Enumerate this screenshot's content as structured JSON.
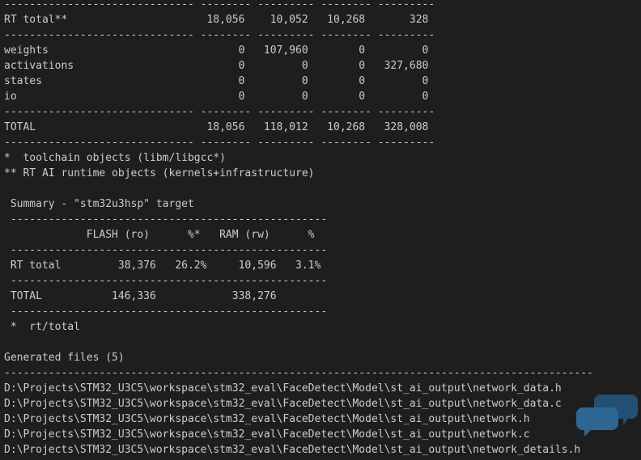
{
  "terminal": {
    "lines": [
      "------------------------------ -------- --------- -------- ---------",
      "RT total**                      18,056    10,052   10,268       328",
      "------------------------------ -------- --------- -------- ---------",
      "weights                              0   107,960        0         0",
      "activations                          0         0        0   327,680",
      "states                               0         0        0         0",
      "io                                   0         0        0         0",
      "------------------------------ -------- --------- -------- ---------",
      "TOTAL                           18,056   118,012   10,268   328,008",
      "------------------------------ -------- --------- -------- ---------",
      "*  toolchain objects (libm/libgcc*)",
      "** RT AI runtime objects (kernels+infrastructure)",
      "",
      " Summary - \"stm32u3hsp\" target",
      " --------------------------------------------------",
      "             FLASH (ro)      %*   RAM (rw)      %",
      " --------------------------------------------------",
      " RT total         38,376   26.2%     10,596   3.1%",
      " --------------------------------------------------",
      " TOTAL           146,336            338,276",
      " --------------------------------------------------",
      " *  rt/total",
      "",
      "Generated files (5)",
      "---------------------------------------------------------------------------------------------",
      "D:\\Projects\\STM32_U3C5\\workspace\\stm32_eval\\FaceDetect\\Model\\st_ai_output\\network_data.h",
      "D:\\Projects\\STM32_U3C5\\workspace\\stm32_eval\\FaceDetect\\Model\\st_ai_output\\network_data.c",
      "D:\\Projects\\STM32_U3C5\\workspace\\stm32_eval\\FaceDetect\\Model\\st_ai_output\\network.h",
      "D:\\Projects\\STM32_U3C5\\workspace\\stm32_eval\\FaceDetect\\Model\\st_ai_output\\network.c",
      "D:\\Projects\\STM32_U3C5\\workspace\\stm32_eval\\FaceDetect\\Model\\st_ai_output\\network_details.h"
    ]
  },
  "colors": {
    "background": "#1e1e1e",
    "text": "#cccccc",
    "watermark": "#2f6f9f"
  },
  "watermark": {
    "icon": "chat-bubbles-icon"
  }
}
